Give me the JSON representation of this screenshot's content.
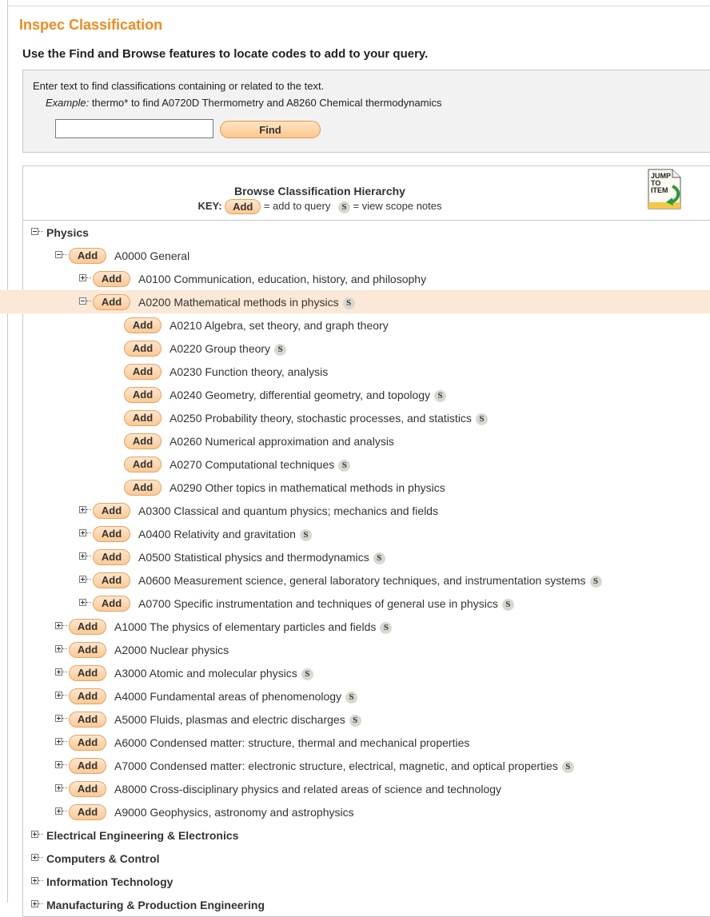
{
  "page": {
    "title": "Inspec Classification",
    "subtitle": "Use the Find and Browse features to locate codes to add to your query."
  },
  "find": {
    "instruction": "Enter text to find classifications containing or related to the text.",
    "example_prefix": "Example:",
    "example_text": " thermo* to find A0720D Thermometry and A8260 Chemical thermodynamics",
    "input_value": "",
    "button_label": "Find"
  },
  "browse": {
    "title": "Browse Classification Hierarchy",
    "key_prefix": "KEY:",
    "key_add_label": "Add",
    "key_add_text": "= add to query",
    "key_scope_label": "S",
    "key_scope_text": "= view scope notes",
    "jump_icon_text": "JUMP TO ITEM"
  },
  "tree": [
    {
      "level": 0,
      "toggle": "minus",
      "add": false,
      "label": "Physics",
      "scope": false,
      "bold": true
    },
    {
      "level": 1,
      "toggle": "minus",
      "add": true,
      "label": "A0000 General",
      "scope": false
    },
    {
      "level": 2,
      "toggle": "plus",
      "add": true,
      "label": "A0100 Communication, education, history, and philosophy",
      "scope": false
    },
    {
      "level": 2,
      "toggle": "minus",
      "add": true,
      "label": "A0200 Mathematical methods in physics",
      "scope": true,
      "selected": true
    },
    {
      "level": 3,
      "toggle": "none",
      "add": true,
      "label": "A0210 Algebra, set theory, and graph theory",
      "scope": false
    },
    {
      "level": 3,
      "toggle": "none",
      "add": true,
      "label": "A0220 Group theory",
      "scope": true
    },
    {
      "level": 3,
      "toggle": "none",
      "add": true,
      "label": "A0230 Function theory, analysis",
      "scope": false
    },
    {
      "level": 3,
      "toggle": "none",
      "add": true,
      "label": "A0240 Geometry, differential geometry, and topology",
      "scope": true
    },
    {
      "level": 3,
      "toggle": "none",
      "add": true,
      "label": "A0250 Probability theory, stochastic processes, and statistics",
      "scope": true
    },
    {
      "level": 3,
      "toggle": "none",
      "add": true,
      "label": "A0260 Numerical approximation and analysis",
      "scope": false
    },
    {
      "level": 3,
      "toggle": "none",
      "add": true,
      "label": "A0270 Computational techniques",
      "scope": true
    },
    {
      "level": 3,
      "toggle": "none",
      "add": true,
      "label": "A0290 Other topics in mathematical methods in physics",
      "scope": false
    },
    {
      "level": 2,
      "toggle": "plus",
      "add": true,
      "label": "A0300 Classical and quantum physics; mechanics and fields",
      "scope": false
    },
    {
      "level": 2,
      "toggle": "plus",
      "add": true,
      "label": "A0400 Relativity and gravitation",
      "scope": true
    },
    {
      "level": 2,
      "toggle": "plus",
      "add": true,
      "label": "A0500 Statistical physics and thermodynamics",
      "scope": true
    },
    {
      "level": 2,
      "toggle": "plus",
      "add": true,
      "label": "A0600 Measurement science, general laboratory techniques, and instrumentation systems",
      "scope": true
    },
    {
      "level": 2,
      "toggle": "plus",
      "add": true,
      "label": "A0700 Specific instrumentation and techniques of general use in physics",
      "scope": true
    },
    {
      "level": 1,
      "toggle": "plus",
      "add": true,
      "label": "A1000 The physics of elementary particles and fields",
      "scope": true
    },
    {
      "level": 1,
      "toggle": "plus",
      "add": true,
      "label": "A2000 Nuclear physics",
      "scope": false
    },
    {
      "level": 1,
      "toggle": "plus",
      "add": true,
      "label": "A3000 Atomic and molecular physics",
      "scope": true
    },
    {
      "level": 1,
      "toggle": "plus",
      "add": true,
      "label": "A4000 Fundamental areas of phenomenology",
      "scope": true
    },
    {
      "level": 1,
      "toggle": "plus",
      "add": true,
      "label": "A5000 Fluids, plasmas and electric discharges",
      "scope": true
    },
    {
      "level": 1,
      "toggle": "plus",
      "add": true,
      "label": "A6000 Condensed matter: structure, thermal and mechanical properties",
      "scope": false
    },
    {
      "level": 1,
      "toggle": "plus",
      "add": true,
      "label": "A7000 Condensed matter: electronic structure, electrical, magnetic, and optical properties",
      "scope": true
    },
    {
      "level": 1,
      "toggle": "plus",
      "add": true,
      "label": "A8000 Cross-disciplinary physics and related areas of science and technology",
      "scope": false
    },
    {
      "level": 1,
      "toggle": "plus",
      "add": true,
      "label": "A9000 Geophysics, astronomy and astrophysics",
      "scope": false
    },
    {
      "level": 0,
      "toggle": "plus",
      "add": false,
      "label": "Electrical Engineering & Electronics",
      "scope": false,
      "bold": true
    },
    {
      "level": 0,
      "toggle": "plus",
      "add": false,
      "label": "Computers & Control",
      "scope": false,
      "bold": true
    },
    {
      "level": 0,
      "toggle": "plus",
      "add": false,
      "label": "Information Technology",
      "scope": false,
      "bold": true
    },
    {
      "level": 0,
      "toggle": "plus",
      "add": false,
      "label": "Manufacturing & Production Engineering",
      "scope": false,
      "bold": true
    }
  ],
  "add_label": "Add",
  "scope_label": "S",
  "colors": {
    "title_orange": "#f08a1d",
    "selected_row": "#fbe8d6",
    "add_button": "#fcc994"
  }
}
